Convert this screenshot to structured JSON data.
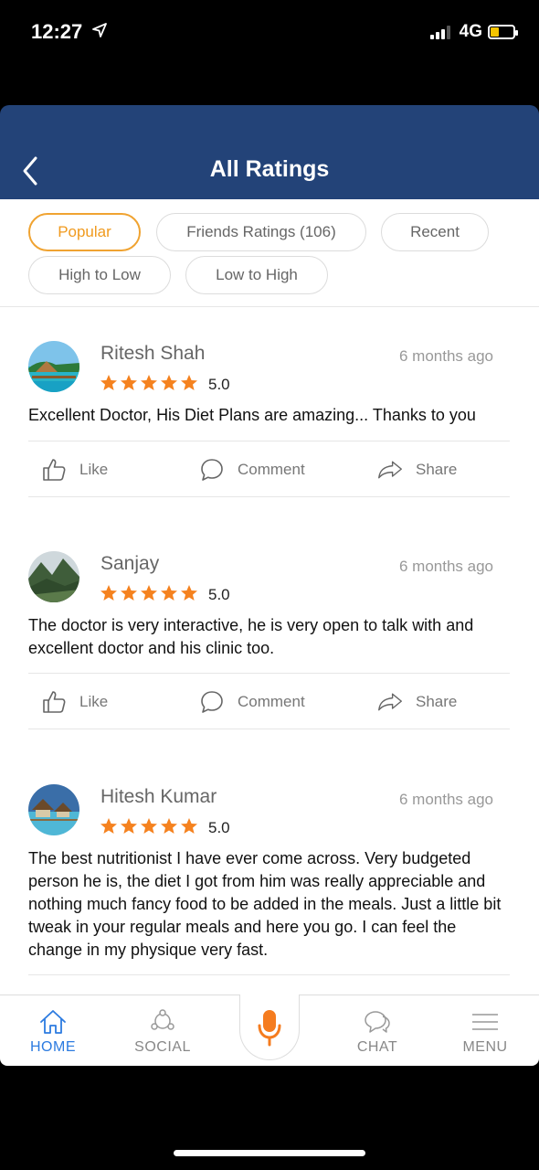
{
  "status_bar": {
    "time": "12:27",
    "network": "4G"
  },
  "header": {
    "title": "All Ratings"
  },
  "filters": [
    {
      "label": "Popular",
      "active": true
    },
    {
      "label": "Friends Ratings (106)",
      "active": false
    },
    {
      "label": "Recent",
      "active": false
    },
    {
      "label": "High to Low",
      "active": false
    },
    {
      "label": "Low to High",
      "active": false
    }
  ],
  "actions": {
    "like": "Like",
    "comment": "Comment",
    "share": "Share"
  },
  "reviews": [
    {
      "name": "Ritesh Shah",
      "time": "6 months ago",
      "stars": 5,
      "score": "5.0",
      "text": "Excellent Doctor, His Diet Plans are amazing... Thanks to you"
    },
    {
      "name": "Sanjay",
      "time": "6 months ago",
      "stars": 5,
      "score": "5.0",
      "text": "The doctor is very interactive, he is very open to talk with and excellent doctor and his clinic too."
    },
    {
      "name": "Hitesh Kumar",
      "time": "6 months ago",
      "stars": 5,
      "score": "5.0",
      "text": "The best nutritionist I have ever come across. Very budgeted person he is, the diet I got from him was really appreciable and nothing much fancy food to be added in the meals. Just a little bit tweak in your regular meals and here you go. I can feel the change in my physique very fast."
    }
  ],
  "bottom_nav": {
    "home": "HOME",
    "social": "SOCIAL",
    "chat": "CHAT",
    "menu": "MENU"
  },
  "colors": {
    "header_bg": "#234378",
    "accent": "#f0a331",
    "star": "#f5821f",
    "active_nav": "#2c7be0"
  }
}
